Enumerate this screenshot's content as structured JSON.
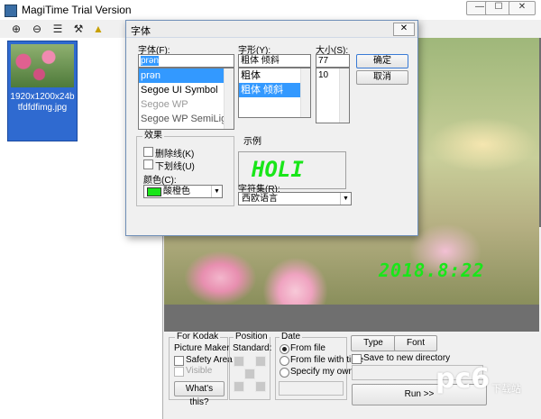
{
  "window": {
    "title": "MagiTime Trial Version",
    "controls": {
      "minimize": "—",
      "maximize": "☐",
      "close": "✕"
    }
  },
  "toolbar": {
    "icons": [
      "add-icon",
      "remove-icon",
      "list-icon",
      "brush-icon"
    ],
    "glyphs": {
      "add": "⊕",
      "remove": "⊖",
      "list": "☰",
      "brush": "⚒"
    }
  },
  "thumbnail": {
    "dims": "1920x1200x24b",
    "filename": "tfdfdfimg.jpg"
  },
  "date_stamp": "2018.8:22",
  "font_dialog": {
    "title": "字体",
    "close": "✕",
    "font_label": "字体(F):",
    "font_value": "prən",
    "fonts": [
      "prən",
      "Segoe UI Symbol",
      "Segoe WP",
      "Segoe WP SemiLight"
    ],
    "style_label": "字形(Y):",
    "style_value": "粗体 倾斜",
    "styles": [
      "粗体",
      "粗体 倾斜"
    ],
    "size_label": "大小(S):",
    "size_value": "77",
    "sizes": [
      "10"
    ],
    "ok_label": "确定",
    "cancel_label": "取消",
    "effects_title": "效果",
    "strikeout_label": "删除线(K)",
    "underline_label": "下划线(U)",
    "color_label": "颜色(C):",
    "color_value": "酸橙色",
    "color_swatch": "#19e619",
    "sample_title": "示例",
    "sample_text": "HOLI",
    "charset_label": "字符集(R):",
    "charset_value": "西欧语言"
  },
  "bottom": {
    "kodak": {
      "title": "For Kodak",
      "line2": "Picture Maker",
      "safety_area": "Safety Area",
      "visible": "Visible",
      "whats_this": "What's this?"
    },
    "position": {
      "title": "Position",
      "standard": "Standard:"
    },
    "date": {
      "title": "Date",
      "from_file": "From file",
      "from_file_time": "From file with time",
      "specify_own": "Specify my own",
      "selected": "From file"
    },
    "type_button": "Type",
    "font_button": "Font",
    "save_new_dir": "Save to new directory",
    "run_button": "Run >>"
  },
  "watermark": {
    "main": "pc6",
    "sub": "下载站"
  }
}
